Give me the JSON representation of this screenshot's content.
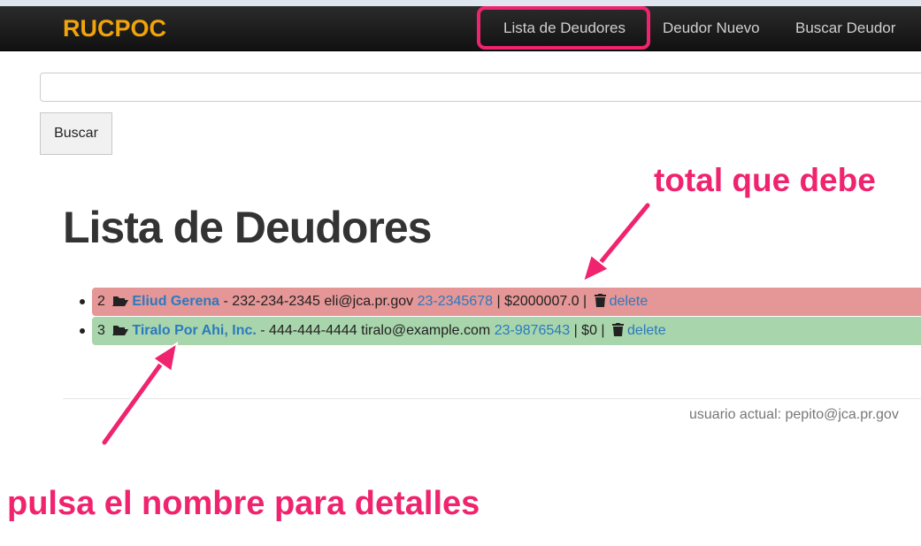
{
  "brand": "RUCPOC",
  "nav": {
    "lista": "Lista de Deudores",
    "nuevo": "Deudor Nuevo",
    "buscar": "Buscar Deudor"
  },
  "search": {
    "value": "",
    "button": "Buscar"
  },
  "page_title": "Lista de Deudores",
  "debtors": [
    {
      "id": "2",
      "name": "Eliud Gerena",
      "phone": "- 232-234-2345",
      "email": "eli@jca.pr.gov",
      "account": "23-2345678",
      "total": "$2000007.0",
      "delete": "delete",
      "row_color": "#e59696"
    },
    {
      "id": "3",
      "name": "Tiralo Por Ahi, Inc.",
      "phone": "- 444-444-4444",
      "email": "tiralo@example.com",
      "account": "23-9876543",
      "total": "$0",
      "delete": "delete",
      "row_color": "#a8d5ab"
    }
  ],
  "footer": {
    "current_user": "usuario actual: pepito@jca.pr.gov"
  },
  "annotations": {
    "total": "total que debe",
    "pulsa": "pulsa el nombre para detalles",
    "color": "#f0236e"
  },
  "icons": [
    "folder-open-icon",
    "trash-icon"
  ]
}
